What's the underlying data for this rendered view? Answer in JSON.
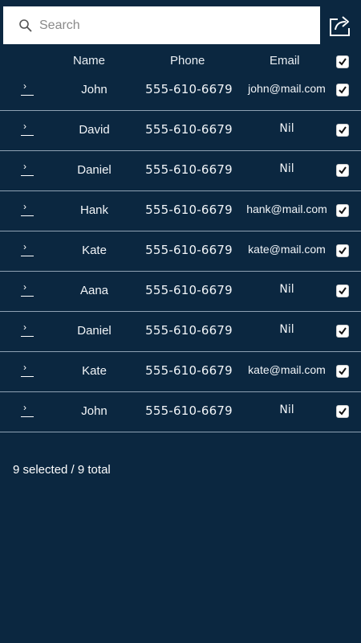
{
  "search": {
    "placeholder": "Search"
  },
  "header": {
    "name": "Name",
    "phone": "Phone",
    "email": "Email",
    "select_all_checked": true
  },
  "contacts": [
    {
      "name": "John",
      "phone": "555-610-6679",
      "email": "john@mail.com",
      "checked": true
    },
    {
      "name": "David",
      "phone": "555-610-6679",
      "email": "Nil",
      "checked": true
    },
    {
      "name": "Daniel",
      "phone": "555-610-6679",
      "email": "Nil",
      "checked": true
    },
    {
      "name": "Hank",
      "phone": "555-610-6679",
      "email": "hank@mail.com",
      "checked": true
    },
    {
      "name": "Kate",
      "phone": "555-610-6679",
      "email": "kate@mail.com",
      "checked": true
    },
    {
      "name": "Aana",
      "phone": "555-610-6679",
      "email": "Nil",
      "checked": true
    },
    {
      "name": "Daniel",
      "phone": "555-610-6679",
      "email": "Nil",
      "checked": true
    },
    {
      "name": "Kate",
      "phone": "555-610-6679",
      "email": "kate@mail.com",
      "checked": true
    },
    {
      "name": "John",
      "phone": "555-610-6679",
      "email": "Nil",
      "checked": true
    }
  ],
  "footer": {
    "status": "9 selected / 9 total"
  },
  "icons": {
    "search": "search-icon",
    "share": "share-icon",
    "row_expand": "chevron-right-icon",
    "check": "checkmark-icon"
  },
  "colors": {
    "background": "#0b2740",
    "row_divider": "#8ea1b3",
    "search_bg": "#ffffff"
  }
}
